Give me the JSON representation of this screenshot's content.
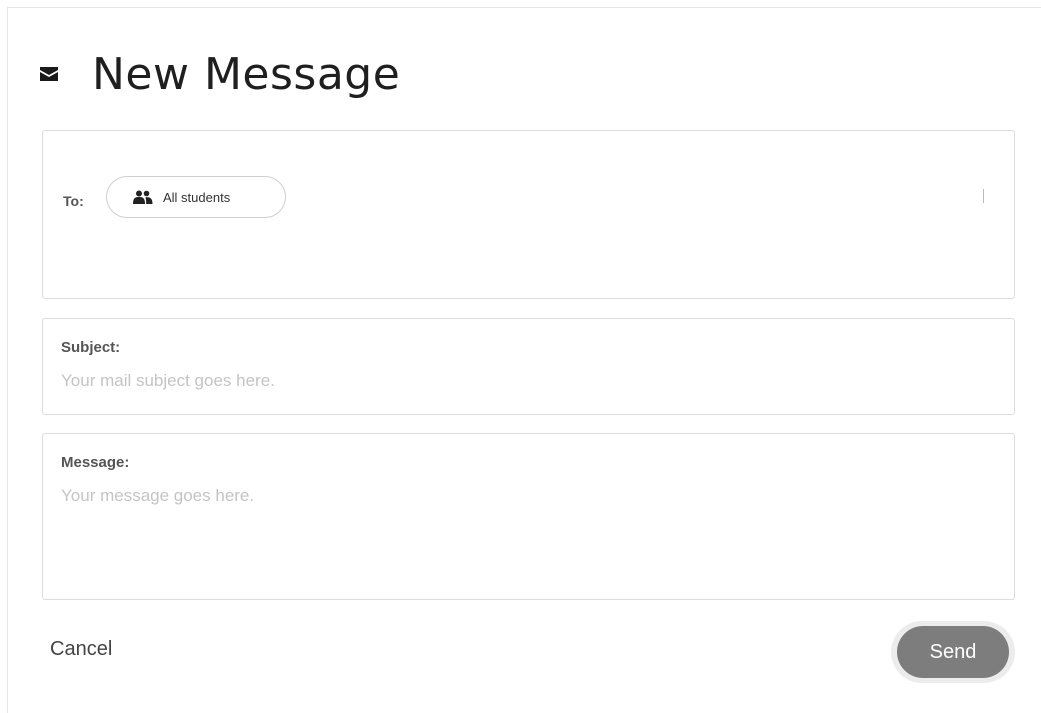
{
  "header": {
    "title": "New Message",
    "icon": "envelope-icon"
  },
  "to": {
    "label": "To:",
    "recipient": {
      "label": "All students",
      "icon": "users-icon"
    }
  },
  "subject": {
    "label": "Subject:",
    "placeholder": "Your mail subject goes here.",
    "value": ""
  },
  "message": {
    "label": "Message:",
    "placeholder": "Your message goes here.",
    "value": ""
  },
  "actions": {
    "cancel_label": "Cancel",
    "send_label": "Send"
  },
  "colors": {
    "send_button": "#7d7d7d",
    "border": "#dcdcdc",
    "placeholder": "#c4c4c4"
  }
}
